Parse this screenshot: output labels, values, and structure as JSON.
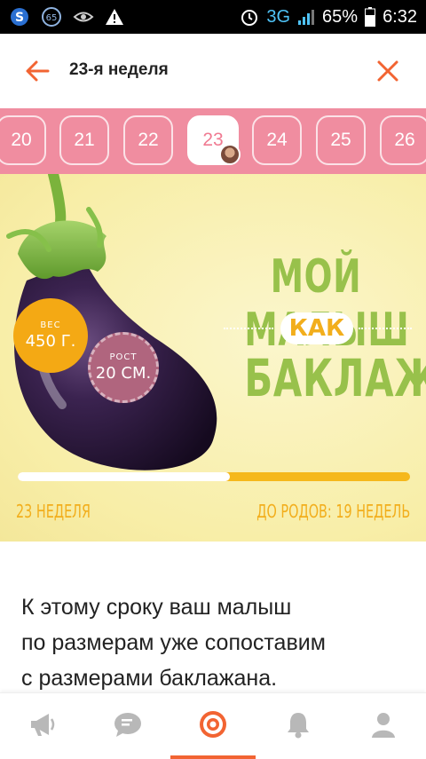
{
  "status_bar": {
    "network": "3G",
    "battery": "65%",
    "time": "6:32",
    "icons": [
      "sync-icon",
      "notification-count-icon",
      "eye-icon",
      "warning-icon",
      "alarm-icon",
      "signal-icon",
      "battery-icon"
    ],
    "notification_count": "65"
  },
  "app_bar": {
    "title": "23-я неделя",
    "accent_color": "#f26432"
  },
  "weeks": {
    "items": [
      "20",
      "21",
      "22",
      "23",
      "24",
      "25",
      "26"
    ],
    "selected": "23",
    "strip_color": "#f08da0"
  },
  "banner": {
    "headline_line1": "МОЙ МАЛЫШ",
    "headline_line2": "КАК",
    "headline_line3": "БАКЛАЖАН",
    "weight_caption": "ВЕС",
    "weight_value": "450 Г.",
    "height_caption": "РОСТ",
    "height_value": "20 СМ.",
    "progress_fraction": 0.54,
    "week_label": "23 НЕДЕЛЯ",
    "remaining_label": "ДО РОДОВ: 19 НЕДЕЛЬ",
    "headline_color": "#98c14b",
    "accent_yellow": "#f4a914"
  },
  "description": {
    "lines": [
      "К этому сроку ваш малыш",
      "по размерам уже сопоставим",
      "с размерами баклажана."
    ]
  },
  "bottom_nav": {
    "items": [
      "announcements-icon",
      "chat-icon",
      "target-icon",
      "bell-icon",
      "profile-icon"
    ],
    "active": "target-icon"
  }
}
